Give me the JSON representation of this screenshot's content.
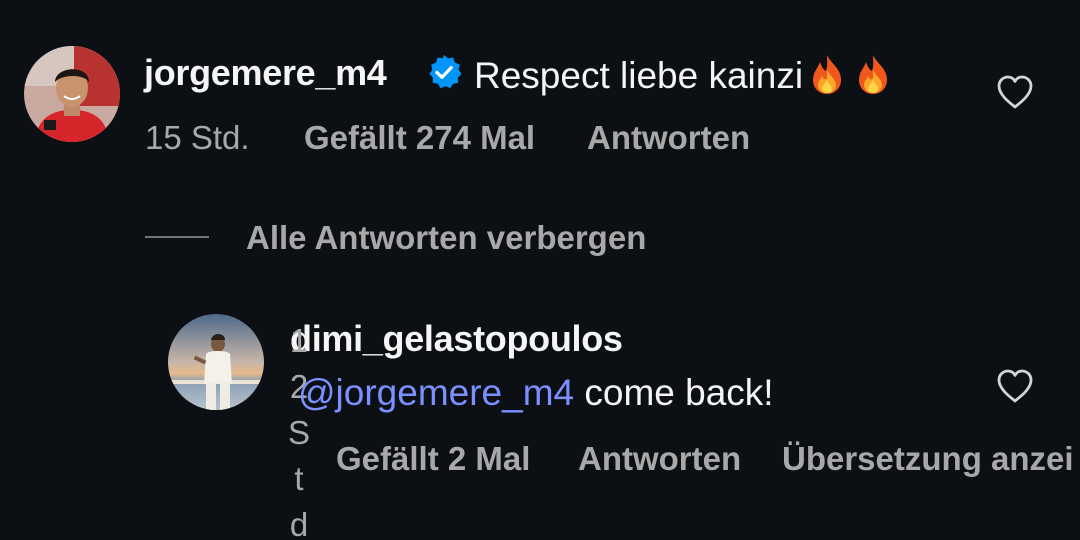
{
  "comment": {
    "username": "jorgemere_m4",
    "verified": true,
    "text": "Respect liebe kainzi",
    "emoji": "fire-emoji fire-emoji",
    "time": "15 Std.",
    "likes": "Gefällt 274 Mal",
    "reply": "Antworten"
  },
  "replies_toggle": {
    "label": "Alle Antworten verbergen"
  },
  "reply": {
    "username": "dimi_gelastopoulos",
    "mention": "@jorgemere_m4",
    "text": " come back!",
    "time_chars": [
      "1",
      "2",
      "S",
      "t",
      "d"
    ],
    "likes": "Gefällt 2 Mal",
    "reply": "Antworten",
    "translate": "Übersetzung anzei"
  },
  "icons": {
    "like": "heart-outline-icon",
    "verified": "verified-badge-icon"
  },
  "colors": {
    "background": "#0c1014",
    "mention": "#7c8fff",
    "verified": "#0095f6",
    "secondary_text": "#a8a8a8"
  }
}
